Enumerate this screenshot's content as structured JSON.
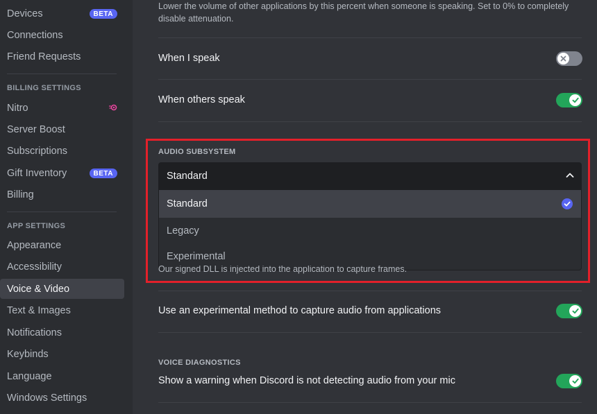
{
  "sidebar": {
    "items_top": [
      {
        "label": "Devices",
        "badge": "BETA"
      },
      {
        "label": "Connections"
      },
      {
        "label": "Friend Requests"
      }
    ],
    "billing_header": "BILLING SETTINGS",
    "billing_items": [
      {
        "label": "Nitro",
        "icon": "nitro-icon"
      },
      {
        "label": "Server Boost"
      },
      {
        "label": "Subscriptions"
      },
      {
        "label": "Gift Inventory",
        "badge": "BETA"
      },
      {
        "label": "Billing"
      }
    ],
    "app_header": "APP SETTINGS",
    "app_items": [
      {
        "label": "Appearance"
      },
      {
        "label": "Accessibility"
      },
      {
        "label": "Voice & Video",
        "active": true
      },
      {
        "label": "Text & Images"
      },
      {
        "label": "Notifications"
      },
      {
        "label": "Keybinds"
      },
      {
        "label": "Language"
      },
      {
        "label": "Windows Settings"
      }
    ]
  },
  "main": {
    "attenuation_desc": "Lower the volume of other applications by this percent when someone is speaking. Set to 0% to completely disable attenuation.",
    "when_i_speak": {
      "label": "When I speak",
      "enabled": false
    },
    "when_others_speak": {
      "label": "When others speak",
      "enabled": true
    },
    "audio_subsystem": {
      "header": "AUDIO SUBSYSTEM",
      "selected": "Standard",
      "options": [
        {
          "label": "Standard",
          "selected": true
        },
        {
          "label": "Legacy"
        },
        {
          "label": "Experimental"
        }
      ]
    },
    "obscured_note": "Our signed DLL is injected into the application to capture frames.",
    "experimental_capture": {
      "label": "Use an experimental method to capture audio from applications",
      "enabled": true
    },
    "voice_diagnostics": {
      "header": "VOICE DIAGNOSTICS",
      "label": "Show a warning when Discord is not detecting audio from your mic",
      "enabled": true
    }
  },
  "colors": {
    "accent": "#5865f2",
    "toggle_on": "#23a55a",
    "toggle_off": "#80848e",
    "highlight_box": "#e3202a"
  }
}
